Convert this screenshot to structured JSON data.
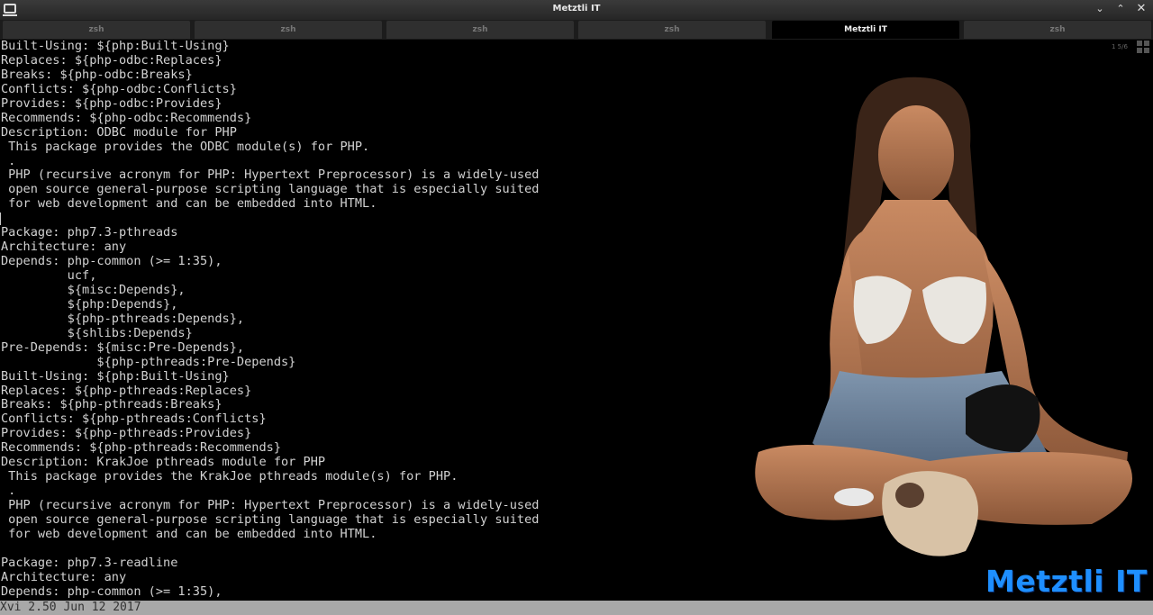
{
  "window": {
    "title": "Metztli IT",
    "minimize_glyph": "⌄",
    "maximize_glyph": "⌃",
    "close_glyph": "✕"
  },
  "tabs": [
    {
      "label": "zsh",
      "active": false
    },
    {
      "label": "zsh",
      "active": false
    },
    {
      "label": "zsh",
      "active": false
    },
    {
      "label": "zsh",
      "active": false
    },
    {
      "label": "Metztli IT",
      "active": true
    },
    {
      "label": "zsh",
      "active": false
    }
  ],
  "pager": "1  5/6",
  "terminal_lines": [
    "Built-Using: ${php:Built-Using}",
    "Replaces: ${php-odbc:Replaces}",
    "Breaks: ${php-odbc:Breaks}",
    "Conflicts: ${php-odbc:Conflicts}",
    "Provides: ${php-odbc:Provides}",
    "Recommends: ${php-odbc:Recommends}",
    "Description: ODBC module for PHP",
    " This package provides the ODBC module(s) for PHP.",
    " .",
    " PHP (recursive acronym for PHP: Hypertext Preprocessor) is a widely-used",
    " open source general-purpose scripting language that is especially suited",
    " for web development and can be embedded into HTML.",
    "",
    "Package: php7.3-pthreads",
    "Architecture: any",
    "Depends: php-common (>= 1:35),",
    "         ucf,",
    "         ${misc:Depends},",
    "         ${php:Depends},",
    "         ${php-pthreads:Depends},",
    "         ${shlibs:Depends}",
    "Pre-Depends: ${misc:Pre-Depends},",
    "             ${php-pthreads:Pre-Depends}",
    "Built-Using: ${php:Built-Using}",
    "Replaces: ${php-pthreads:Replaces}",
    "Breaks: ${php-pthreads:Breaks}",
    "Conflicts: ${php-pthreads:Conflicts}",
    "Provides: ${php-pthreads:Provides}",
    "Recommends: ${php-pthreads:Recommends}",
    "Description: KrakJoe pthreads module for PHP",
    " This package provides the KrakJoe pthreads module(s) for PHP.",
    " .",
    " PHP (recursive acronym for PHP: Hypertext Preprocessor) is a widely-used",
    " open source general-purpose scripting language that is especially suited",
    " for web development and can be embedded into HTML.",
    "",
    "Package: php7.3-readline",
    "Architecture: any",
    "Depends: php-common (>= 1:35),"
  ],
  "status_line": "Xvi 2.50 Jun 12 2017",
  "brand_logo": "Metztli IT",
  "colors": {
    "brand": "#1e8fff",
    "terminal_text": "#d2d2d2",
    "status_bg": "#a8a8a8"
  }
}
